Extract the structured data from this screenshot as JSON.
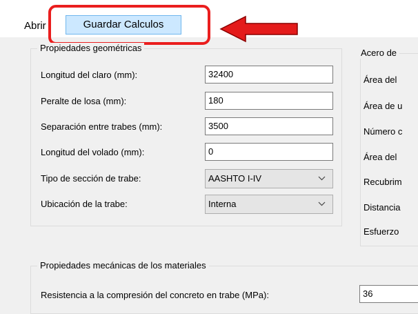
{
  "menu": {
    "open_label": "Abrir",
    "save_label": "Guardar Calculos"
  },
  "geometric": {
    "title": "Propiedades geométricas",
    "fields": [
      {
        "label": "Longitud del claro (mm):",
        "value": "32400"
      },
      {
        "label": "Peralte de losa (mm):",
        "value": "180"
      },
      {
        "label": "Separación entre trabes (mm):",
        "value": "3500"
      },
      {
        "label": "Longitud del volado (mm):",
        "value": "0"
      }
    ],
    "section_type": {
      "label": "Tipo de sección de trabe:",
      "value": "AASHTO I-IV"
    },
    "location": {
      "label": "Ubicación de la trabe:",
      "value": "Interna"
    }
  },
  "steel": {
    "title": "Acero de",
    "labels": [
      "Área del",
      "Área de u",
      "Número c",
      "Área del",
      "Recubrim",
      "Distancia",
      "Esfuerzo"
    ]
  },
  "mechanical": {
    "title": "Propiedades mecánicas de los materiales",
    "fields": [
      {
        "label": "Resistencia a la compresión del concreto en trabe (MPa):",
        "value": "36"
      }
    ]
  },
  "annotation": {
    "highlight_color": "#ea1e1e"
  }
}
